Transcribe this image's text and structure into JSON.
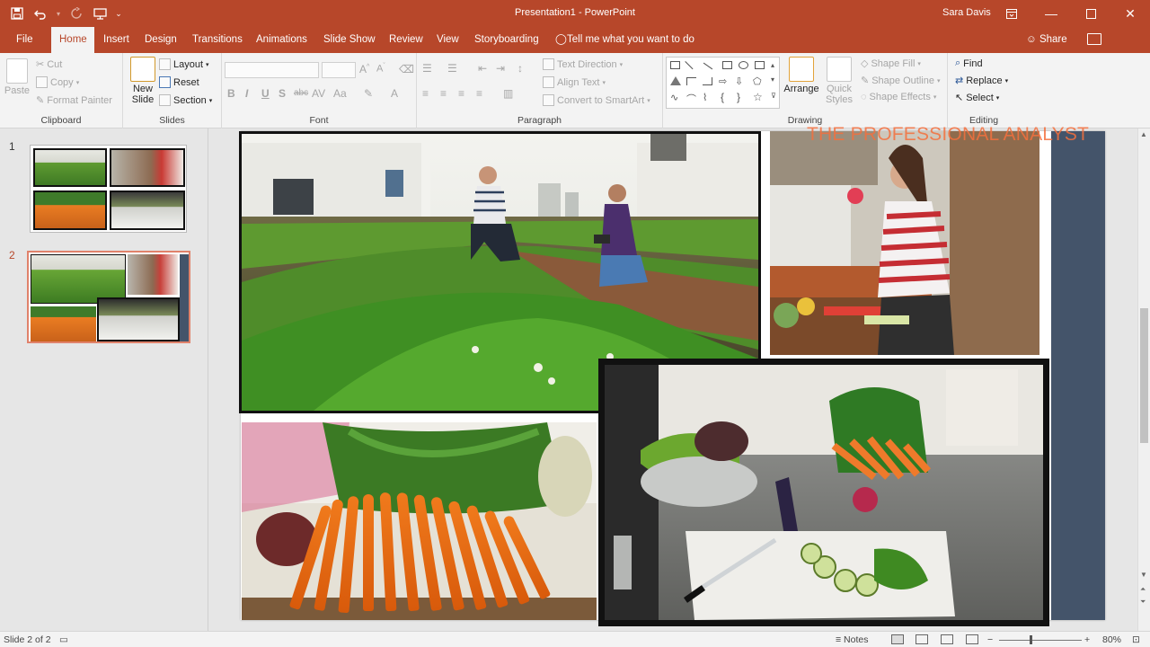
{
  "app": {
    "document_title": "Presentation1  -  PowerPoint",
    "user": "Sara Davis"
  },
  "tabs": [
    {
      "label": "File"
    },
    {
      "label": "Home"
    },
    {
      "label": "Insert"
    },
    {
      "label": "Design"
    },
    {
      "label": "Transitions"
    },
    {
      "label": "Animations"
    },
    {
      "label": "Slide Show"
    },
    {
      "label": "Review"
    },
    {
      "label": "View"
    },
    {
      "label": "Storyboarding"
    }
  ],
  "tellme": "Tell me what you want to do",
  "share": "Share",
  "ribbon": {
    "clipboard": {
      "paste": "Paste",
      "cut": "Cut",
      "copy": "Copy",
      "format_painter": "Format Painter",
      "label": "Clipboard"
    },
    "slides": {
      "new_slide": "New",
      "new_slide2": "Slide",
      "layout": "Layout",
      "reset": "Reset",
      "section": "Section",
      "label": "Slides"
    },
    "font": {
      "bold": "B",
      "italic": "I",
      "underline": "U",
      "strike": "S",
      "label": "Font"
    },
    "paragraph": {
      "text_direction": "Text Direction",
      "align_text": "Align Text",
      "convert_smartart": "Convert to SmartArt",
      "label": "Paragraph"
    },
    "drawing": {
      "arrange": "Arrange",
      "quick_styles": "Quick",
      "quick_styles2": "Styles",
      "shape_fill": "Shape Fill",
      "shape_outline": "Shape Outline",
      "shape_effects": "Shape Effects",
      "label": "Drawing"
    },
    "editing": {
      "find": "Find",
      "replace": "Replace",
      "select": "Select",
      "label": "Editing"
    }
  },
  "thumbnails": [
    {
      "number": "1"
    },
    {
      "number": "2"
    }
  ],
  "slide": {
    "watermark": "THE PROFESSIONAL ANALYST"
  },
  "status": {
    "slide_of": "Slide 2 of 2",
    "notes": "Notes",
    "zoom": "80%"
  },
  "colors": {
    "accent": "#b7472a",
    "side_panel": "#44546a",
    "watermark": "#f4703e"
  }
}
